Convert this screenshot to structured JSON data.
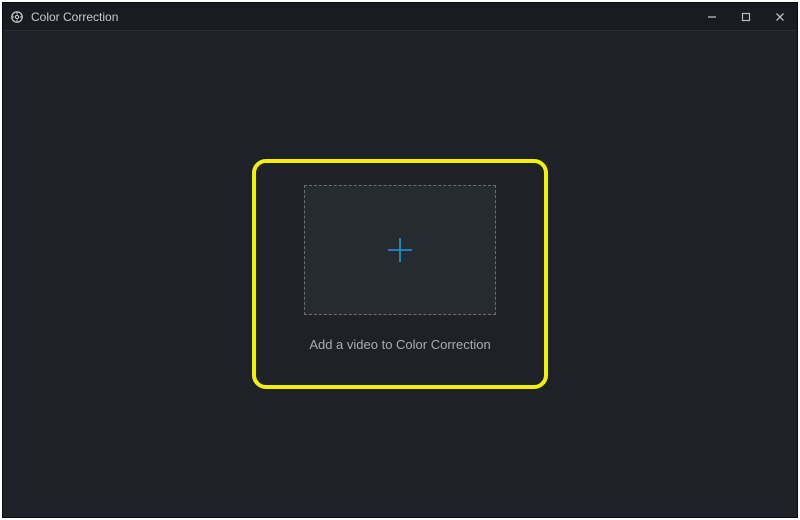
{
  "window": {
    "title": "Color Correction"
  },
  "dropzone": {
    "caption": "Add a video to Color Correction"
  }
}
